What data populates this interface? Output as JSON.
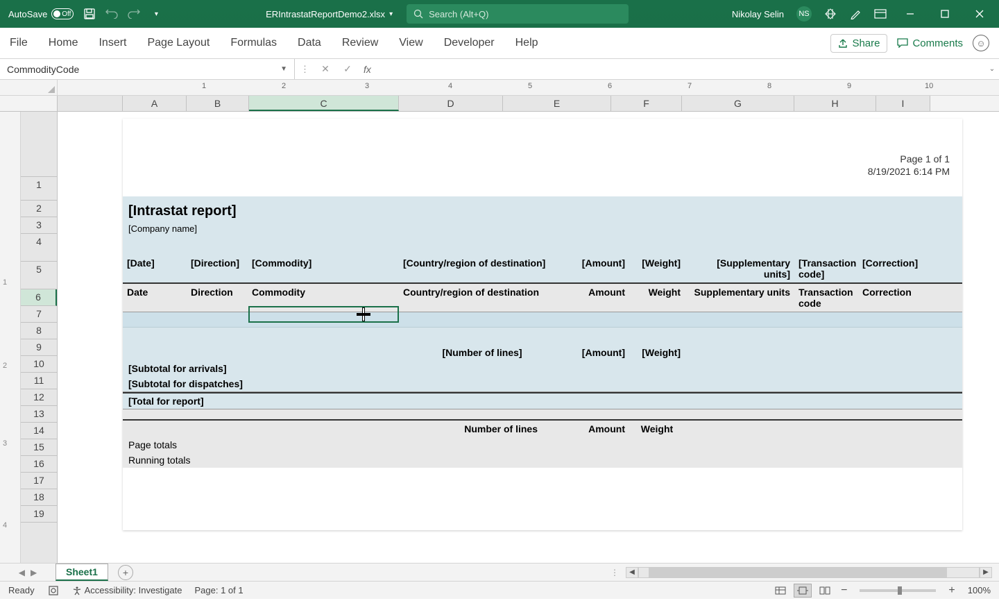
{
  "title_bar": {
    "autosave": "AutoSave",
    "autosave_state": "Off",
    "filename": "ERIntrastatReportDemo2.xlsx",
    "search_placeholder": "Search (Alt+Q)",
    "user_name": "Nikolay Selin",
    "user_initials": "NS"
  },
  "ribbon": {
    "tabs": [
      "File",
      "Home",
      "Insert",
      "Page Layout",
      "Formulas",
      "Data",
      "Review",
      "View",
      "Developer",
      "Help"
    ],
    "share": "Share",
    "comments": "Comments"
  },
  "formula_bar": {
    "name_box": "CommodityCode",
    "formula": ""
  },
  "columns": [
    "A",
    "B",
    "C",
    "D",
    "E",
    "F",
    "G",
    "H",
    "I"
  ],
  "active_column_index": 2,
  "rows": [
    1,
    2,
    3,
    4,
    5,
    6,
    7,
    8,
    9,
    10,
    11,
    12,
    13,
    14,
    15,
    16,
    17,
    18,
    19
  ],
  "active_row": 6,
  "ruler_ticks": [
    "1",
    "2",
    "3",
    "4",
    "5",
    "6",
    "7",
    "8",
    "9",
    "10"
  ],
  "page_markers": [
    "1",
    "2",
    "3",
    "4"
  ],
  "page_header": {
    "page_info": "Page 1 of  1",
    "datetime": "8/19/2021 6:14 PM"
  },
  "report": {
    "title": "[Intrastat report]",
    "company": "[Company name]",
    "template_headers": {
      "date": "[Date]",
      "direction": "[Direction]",
      "commodity": "[Commodity]",
      "country": "[Country/region of destination]",
      "amount": "[Amount]",
      "weight": "[Weight]",
      "supplementary": "[Supplementary units]",
      "transaction": "[Transaction code]",
      "correction": "[Correction]"
    },
    "data_headers": {
      "date": "Date",
      "direction": "Direction",
      "commodity": "Commodity",
      "country": "Country/region of destination",
      "amount": "Amount",
      "weight": "Weight",
      "supplementary": "Supplementary units",
      "transaction": "Transaction code",
      "correction": "Correction"
    },
    "summary_template": {
      "lines": "[Number of lines]",
      "amount": "[Amount]",
      "weight": "[Weight]"
    },
    "subtotal_arrivals": "[Subtotal for arrivals]",
    "subtotal_dispatches": "[Subtotal for dispatches]",
    "total": "[Total for report]",
    "footer_headers": {
      "lines": "Number of lines",
      "amount": "Amount",
      "weight": "Weight"
    },
    "page_totals": "Page totals",
    "running_totals": "Running totals"
  },
  "sheet_tabs": {
    "active": "Sheet1"
  },
  "status_bar": {
    "ready": "Ready",
    "accessibility": "Accessibility: Investigate",
    "page": "Page: 1 of 1",
    "zoom": "100%"
  }
}
